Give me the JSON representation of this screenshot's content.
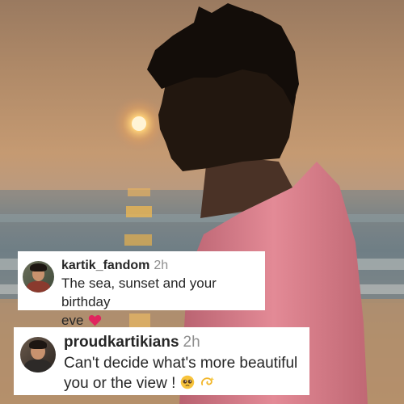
{
  "photo": {
    "description_icon": "sunset-beach-photo"
  },
  "comments": [
    {
      "username": "kartik_fandom",
      "time": "2h",
      "text_line1": "The sea, sunset and your birthday",
      "text_line2": "eve",
      "emoji": "red-heart-icon"
    },
    {
      "username": "proudkartikians",
      "time": "2h",
      "text_line1": "Can't decide what's more beautiful",
      "text_line2": "you or the view !",
      "emojis": [
        "pleading-face-icon",
        "dizzy-icon"
      ]
    }
  ],
  "colors": {
    "username": "#262626",
    "timestamp": "#8e8e8e",
    "heart": "#e0245e",
    "shirt": "#e0818e"
  }
}
